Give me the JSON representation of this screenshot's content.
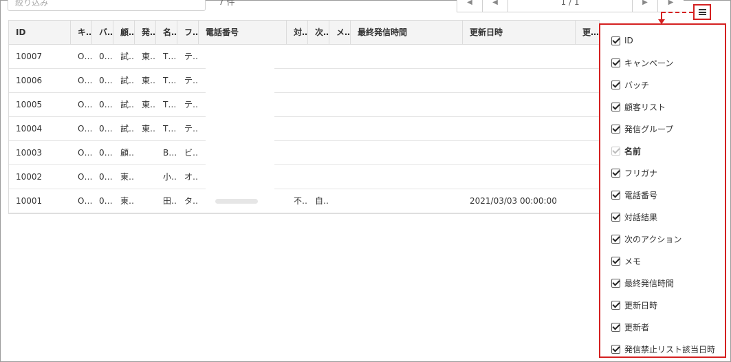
{
  "toolbar": {
    "filter_placeholder": "絞り込み",
    "record_count": "7 件",
    "page_info": "1 / 1",
    "first_icon": "first-page-icon",
    "prev_icon": "prev-page-icon",
    "next_icon": "next-page-icon",
    "last_icon": "last-page-icon",
    "menu_icon": "hamburger-icon"
  },
  "accent_color": "#d42020",
  "table": {
    "headers": [
      "ID",
      "キ…",
      "バ…",
      "顧…",
      "発…",
      "名…",
      "フ…",
      "電話番号",
      "対…",
      "次…",
      "メ…",
      "最終発信時間",
      "更新日時",
      "更…"
    ],
    "rows": [
      [
        "10007",
        "O…",
        "0…",
        "試…",
        "東…",
        "T…",
        "テ…",
        "",
        "",
        "",
        "",
        "",
        "",
        ""
      ],
      [
        "10006",
        "O…",
        "0…",
        "試…",
        "東…",
        "T…",
        "テ…",
        "",
        "",
        "",
        "",
        "",
        "",
        ""
      ],
      [
        "10005",
        "O…",
        "0…",
        "試…",
        "東…",
        "T…",
        "テ…",
        "",
        "",
        "",
        "",
        "",
        "",
        ""
      ],
      [
        "10004",
        "O…",
        "0…",
        "試…",
        "東…",
        "T…",
        "テ…",
        "",
        "",
        "",
        "",
        "",
        "",
        ""
      ],
      [
        "10003",
        "O…",
        "0…",
        "顧…",
        "",
        "B…",
        "ビ…",
        "",
        "",
        "",
        "",
        "",
        "",
        ""
      ],
      [
        "10002",
        "O…",
        "0…",
        "東…",
        "",
        "小…",
        "オ…",
        "",
        "",
        "",
        "",
        "",
        "",
        ""
      ],
      [
        "10001",
        "O…",
        "0…",
        "東…",
        "",
        "田…",
        "タ…",
        "",
        "不…",
        "自…",
        "",
        "",
        "2021/03/03 00:00:00",
        ""
      ]
    ]
  },
  "column_panel": {
    "items": [
      {
        "label": "ID",
        "checked": true,
        "disabled": false
      },
      {
        "label": "キャンペーン",
        "checked": true,
        "disabled": false
      },
      {
        "label": "バッチ",
        "checked": true,
        "disabled": false
      },
      {
        "label": "顧客リスト",
        "checked": true,
        "disabled": false
      },
      {
        "label": "発信グループ",
        "checked": true,
        "disabled": false
      },
      {
        "label": "名前",
        "checked": true,
        "disabled": true
      },
      {
        "label": "フリガナ",
        "checked": true,
        "disabled": false
      },
      {
        "label": "電話番号",
        "checked": true,
        "disabled": false
      },
      {
        "label": "対話結果",
        "checked": true,
        "disabled": false
      },
      {
        "label": "次のアクション",
        "checked": true,
        "disabled": false
      },
      {
        "label": "メモ",
        "checked": true,
        "disabled": false
      },
      {
        "label": "最終発信時間",
        "checked": true,
        "disabled": false
      },
      {
        "label": "更新日時",
        "checked": true,
        "disabled": false
      },
      {
        "label": "更新者",
        "checked": true,
        "disabled": false
      },
      {
        "label": "発信禁止リスト該当日時",
        "checked": true,
        "disabled": false
      }
    ]
  }
}
